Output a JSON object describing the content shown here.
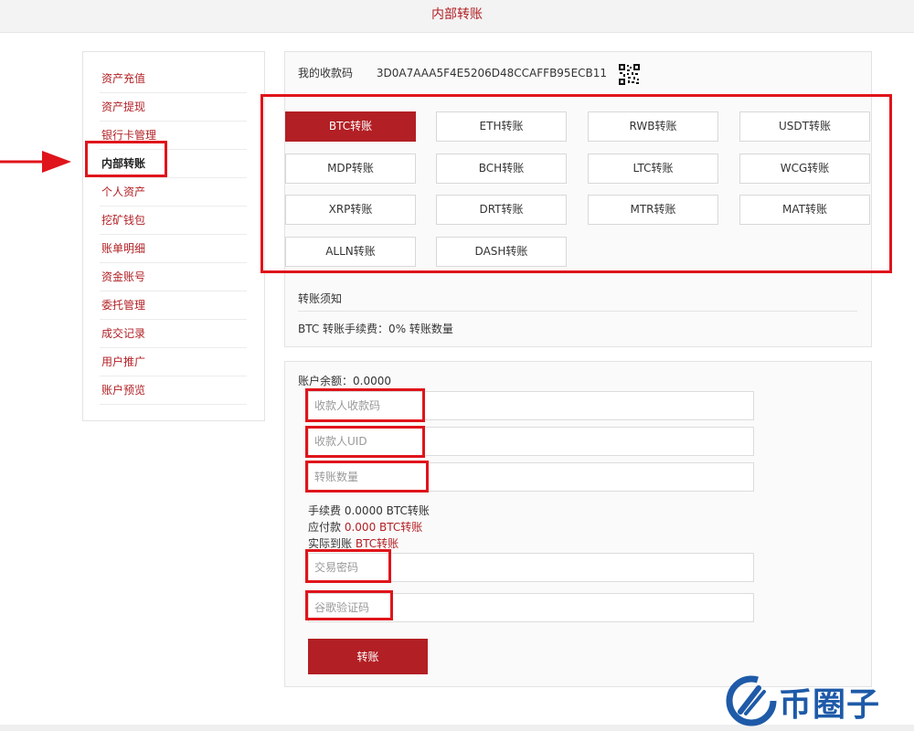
{
  "header": {
    "title": "内部转账"
  },
  "sidebar": {
    "items": [
      {
        "label": "资产充值"
      },
      {
        "label": "资产提现"
      },
      {
        "label": "银行卡管理"
      },
      {
        "label": "内部转账"
      },
      {
        "label": "个人资产"
      },
      {
        "label": "挖矿钱包"
      },
      {
        "label": "账单明细"
      },
      {
        "label": "资金账号"
      },
      {
        "label": "委托管理"
      },
      {
        "label": "成交记录"
      },
      {
        "label": "用户推广"
      },
      {
        "label": "账户预览"
      }
    ],
    "active_index": 3
  },
  "receive": {
    "label": "我的收款码",
    "code": "3D0A7AAA5F4E5206D48CCAFFB95ECB11"
  },
  "coins": [
    {
      "label": "BTC转账"
    },
    {
      "label": "ETH转账"
    },
    {
      "label": "RWB转账"
    },
    {
      "label": "USDT转账"
    },
    {
      "label": "MDP转账"
    },
    {
      "label": "BCH转账"
    },
    {
      "label": "LTC转账"
    },
    {
      "label": "WCG转账"
    },
    {
      "label": "XRP转账"
    },
    {
      "label": "DRT转账"
    },
    {
      "label": "MTR转账"
    },
    {
      "label": "MAT转账"
    },
    {
      "label": "ALLN转账"
    },
    {
      "label": "DASH转账"
    }
  ],
  "coin_active_index": 0,
  "notice": {
    "title": "转账须知",
    "fee_text": "BTC 转账手续费：0% 转账数量"
  },
  "form": {
    "balance": "账户余额：0.0000",
    "payee_code_placeholder": "收款人收款码",
    "payee_uid_placeholder": "收款人UID",
    "amount_placeholder": "转账数量",
    "fee_label": "手续费",
    "fee_value": "0.0000 BTC转账",
    "payable_label": "应付款",
    "payable_value": "0.000 BTC转账",
    "actual_label": "实际到账",
    "actual_value": "BTC转账",
    "trade_password_placeholder": "交易密码",
    "google_code_placeholder": "谷歌验证码",
    "submit_label": "转账"
  },
  "watermark": {
    "text": "币圈子"
  },
  "colors": {
    "accent": "#b21f24",
    "annotation": "#e0141b",
    "watermark": "#1e5aa8"
  }
}
